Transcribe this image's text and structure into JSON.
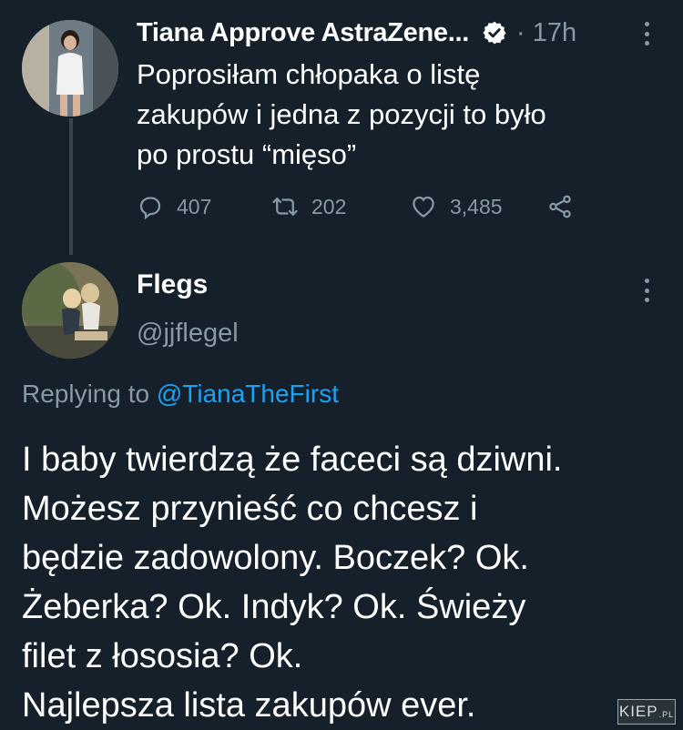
{
  "tweet1": {
    "display_name": "Tiana Approve AstraZene...",
    "separator": "·",
    "time": "17h",
    "text_lines": [
      "Poprosiłam chłopaka o listę",
      "zakupów i jedna z pozycji to było",
      "po prostu “mięso”"
    ],
    "reply_count": "407",
    "retweet_count": "202",
    "like_count": "3,485"
  },
  "tweet2": {
    "display_name": "Flegs",
    "handle": "@jjflegel",
    "replying_prefix": "Replying to",
    "replying_to": "@TianaTheFirst",
    "text_lines": [
      "I baby twierdzą że faceci są dziwni.",
      "Możesz przynieść co chcesz i",
      "będzie zadowolony. Boczek? Ok.",
      "Żeberka? Ok. Indyk? Ok. Świeży",
      "filet z łososia? Ok.",
      "Najlepsza lista zakupów ever."
    ]
  },
  "watermark": {
    "main": "KIEP",
    "suffix": ".PL"
  },
  "colors": {
    "background": "#15202b",
    "secondary_text": "#8899a6",
    "link": "#1da1f2",
    "thread_line": "#38444d"
  }
}
